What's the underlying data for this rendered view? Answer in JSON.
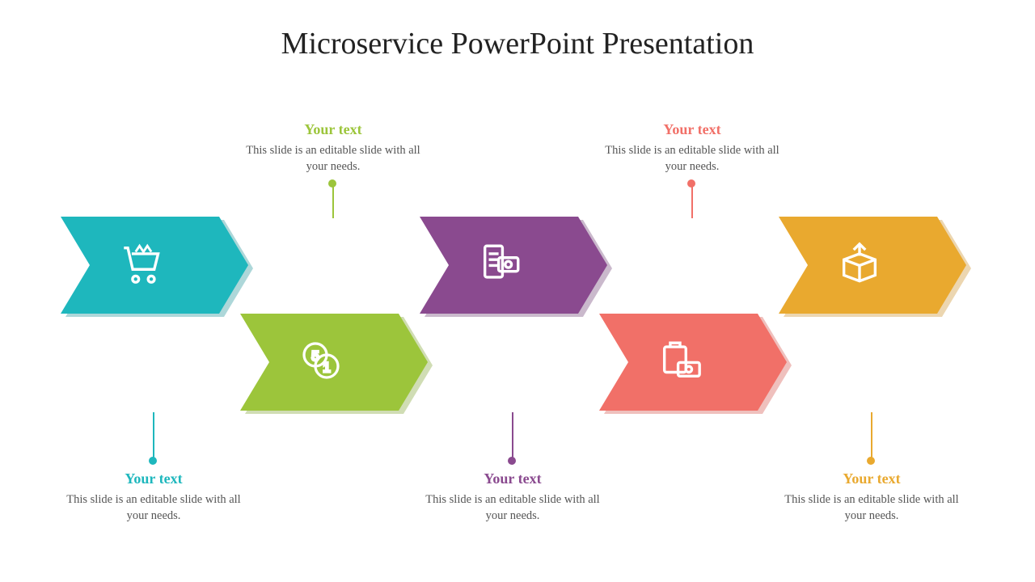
{
  "chart_data": {
    "type": "process-chevron",
    "title": "Microservice PowerPoint Presentation",
    "steps": [
      {
        "index": 1,
        "row": "top",
        "color": "#1eb7bd",
        "icon": "cart",
        "label": "Your text",
        "desc": "This slide is an editable slide with all your needs.",
        "callout": "below"
      },
      {
        "index": 2,
        "row": "bottom",
        "color": "#9cc53b",
        "icon": "coins",
        "label": "Your text",
        "desc": "This slide is an editable slide with all your needs.",
        "callout": "above"
      },
      {
        "index": 3,
        "row": "top",
        "color": "#8a4a8f",
        "icon": "receipt",
        "label": "Your text",
        "desc": "This slide is an editable slide with all your needs.",
        "callout": "below"
      },
      {
        "index": 4,
        "row": "bottom",
        "color": "#f17068",
        "icon": "bag-cash",
        "label": "Your text",
        "desc": "This slide is an editable slide with all your needs.",
        "callout": "above"
      },
      {
        "index": 5,
        "row": "top",
        "color": "#e9a92f",
        "icon": "box",
        "label": "Your text",
        "desc": "This slide is an editable slide with all your needs.",
        "callout": "below"
      }
    ]
  },
  "title": "Microservice PowerPoint Presentation",
  "placeholder_heading": "Your text",
  "placeholder_body": "This slide is an editable slide with all your needs.",
  "colors": {
    "teal": "#1eb7bd",
    "green": "#9cc53b",
    "purple": "#8a4a8f",
    "coral": "#f17068",
    "amber": "#e9a92f",
    "teal_d": "#168e93",
    "green_d": "#7aa02b",
    "purple_d": "#6b3a70",
    "coral_d": "#d24e46",
    "amber_d": "#c98b1f"
  }
}
